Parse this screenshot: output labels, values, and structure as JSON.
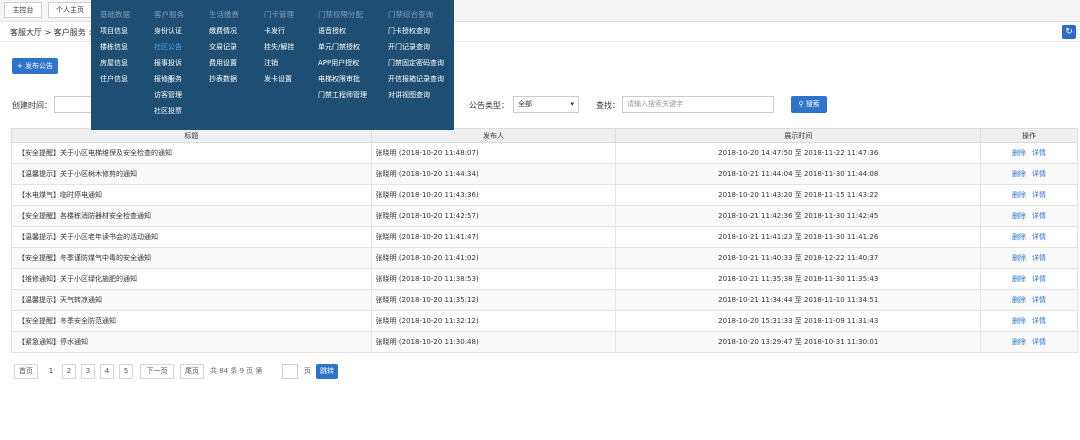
{
  "tabs": [
    "主控台",
    "个人主页"
  ],
  "breadcrumb": "客服大厅 > 客户服务 >",
  "publish_button": "发布公告",
  "filters": {
    "created_label": "创建时间：",
    "type_label": "公告类型：",
    "type_value": "全部",
    "search_label": "查找：",
    "search_placeholder": "请输入搜索关键字",
    "search_button": "搜索"
  },
  "table": {
    "headers": [
      "标题",
      "发布人",
      "展示时间",
      "操作"
    ],
    "actions": [
      "删除",
      "详情"
    ],
    "rows": [
      {
        "title": "【安全提醒】关于小区电梯维保及安全检查的通知",
        "publisher": "张晓明 (2018-10-20 11:48:07)",
        "time": "2018-10-20 14:47:50 至 2018-11-22 11:47:36"
      },
      {
        "title": "【温馨提示】关于小区树木修剪的通知",
        "publisher": "张晓明 (2018-10-20 11:44:34)",
        "time": "2018-10-21 11:44:04 至 2018-11-30 11:44:08"
      },
      {
        "title": "【水电煤气】临时停电通知",
        "publisher": "张晓明 (2018-10-20 11:43:36)",
        "time": "2018-10-20 11:43:20 至 2018-11-15 11:43:22"
      },
      {
        "title": "【安全提醒】各楼栋消防器材安全检查通知",
        "publisher": "张晓明 (2018-10-20 11:42:57)",
        "time": "2018-10-21 11:42:36 至 2018-11-30 11:42:45"
      },
      {
        "title": "【温馨提示】关于小区老年读书会的活动通知",
        "publisher": "张晓明 (2018-10-20 11:41:47)",
        "time": "2018-10-21 11:41:23 至 2018-11-30 11:41:26"
      },
      {
        "title": "【安全提醒】冬季谨防煤气中毒的安全通知",
        "publisher": "张晓明 (2018-10-20 11:41:02)",
        "time": "2018-10-21 11:40:33 至 2018-12-22 11:40:37"
      },
      {
        "title": "【维修通知】关于小区绿化施肥的通知",
        "publisher": "张晓明 (2018-10-20 11:38:53)",
        "time": "2018-10-21 11:35:38 至 2018-11-30 11:35:43"
      },
      {
        "title": "【温馨提示】天气转凉通知",
        "publisher": "张晓明 (2018-10-20 11:35:12)",
        "time": "2018-10-21 11:34:44 至 2018-11-10 11:34:51"
      },
      {
        "title": "【安全提醒】冬季安全防范通知",
        "publisher": "张晓明 (2018-10-20 11:32:12)",
        "time": "2018-10-20 15:31:33 至 2018-11-09 11:31:43"
      },
      {
        "title": "【紧急通知】停水通知",
        "publisher": "张晓明 (2018-10-20 11:30:48)",
        "time": "2018-10-20 13:29:47 至 2018-10-31 11:30:01"
      }
    ]
  },
  "pagination": {
    "first": "首页",
    "pages": [
      "1",
      "2",
      "3",
      "4",
      "5"
    ],
    "next": "下一页",
    "last": "尾页",
    "summary": "共 84 条  9 页  第",
    "page_unit": "页",
    "go": "跳转"
  },
  "menu": {
    "columns": [
      {
        "head": "基础数据",
        "items": [
          "项目信息",
          "楼栋信息",
          "房屋信息",
          "住户信息"
        ]
      },
      {
        "head": "客户服务",
        "items": [
          "身份认证",
          "社区公告",
          "报事投诉",
          "报修服务",
          "访客管理",
          "社区投票"
        ]
      },
      {
        "head": "生活缴费",
        "items": [
          "缴费情况",
          "交易记录",
          "费用设置",
          "抄表数据"
        ]
      },
      {
        "head": "门卡管理",
        "items": [
          "卡发行",
          "挂失/解挂",
          "注销",
          "发卡设置"
        ]
      },
      {
        "head": "门禁权限分配",
        "items": [
          "语音授权",
          "单元门禁授权",
          "APP用户授权",
          "电梯权限审批",
          "门禁工程师管理"
        ]
      },
      {
        "head": "门禁综合查询",
        "items": [
          "门卡授权查询",
          "开门记录查询",
          "门禁固定密码查询",
          "开信报箱记录查询",
          "对讲视图查询"
        ]
      }
    ],
    "active_item": "社区公告"
  },
  "colors": {
    "menu_bg": "#1f4e73",
    "primary": "#2f74c9",
    "active_menu": "#4aa8ff"
  }
}
